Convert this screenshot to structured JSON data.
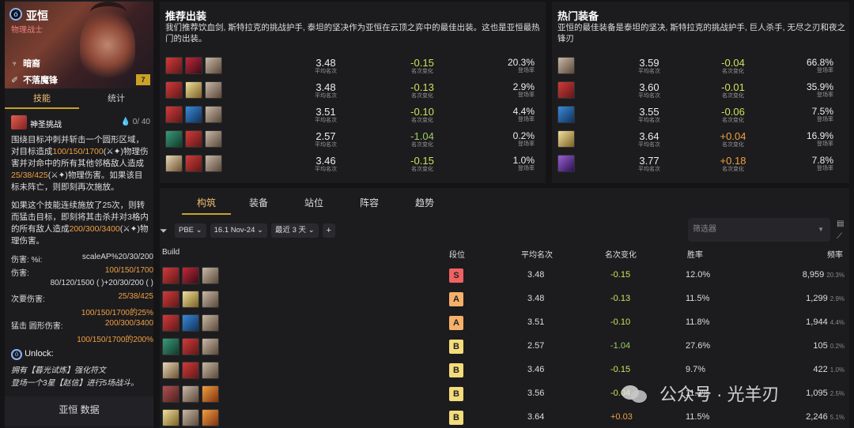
{
  "champion": {
    "name": "亚恒",
    "role": "物理战士",
    "cost": "7",
    "traits": [
      "暗裔",
      "不落魔锋"
    ],
    "tabs": [
      "技能",
      "统计"
    ],
    "ability": {
      "name": "神圣挑战",
      "mana": "0",
      "mana_max": "/ 40",
      "text1": "围绕目标冲刺并斩击一个圆形区域，对目标造成",
      "text1_num": "100/150/1700",
      "text1b": "物理伤害并对命中的所有其他邻格敌人造成",
      "text1_num2": "25/38/425",
      "text1c": "物理伤害。如果该目标未阵亡，则即刻再次施放。",
      "text2": "如果这个技能连续施放了25次，则转而猛击目标，即刻将其击杀并对3格内的所有敌人造成",
      "text2_num": "200/300/3400",
      "text2b": "物理伤害。"
    },
    "stats": [
      {
        "label": "伤害: %i:",
        "value": "scaleAP%20/30/200"
      },
      {
        "label": "伤害:",
        "value": "100/150/1700"
      },
      {
        "label": "",
        "value": "80/120/1500 (    )+20/30/200 (  )"
      },
      {
        "label": "次要伤害:",
        "value": "25/38/425"
      },
      {
        "label": "",
        "value": "100/150/1700的25%"
      },
      {
        "label": "猛击 圆形伤害:",
        "value": "200/300/3400"
      },
      {
        "label": "",
        "value": "100/150/1700的200%"
      }
    ],
    "unlock": {
      "title": "Unlock:",
      "line1": "拥有【暮光试炼】强化符文",
      "line2": "登场一个3星【赵信】进行5场战斗。"
    },
    "data_button": "亚恒 数据"
  },
  "recommended": {
    "title": "推荐出装",
    "desc": "我们推荐饮血剑, 斯特拉克的挑战护手, 泰坦的坚决作为亚恒在云顶之弈中的最佳出装。这也是亚恒最热门的出装。",
    "rows": [
      {
        "items": [
          "c1",
          "c2",
          "c3"
        ],
        "avg": "3.48",
        "chg": "-0.15",
        "chgc": "neg",
        "rate": "20.3%"
      },
      {
        "items": [
          "c1",
          "c4",
          "c3"
        ],
        "avg": "3.48",
        "chg": "-0.13",
        "chgc": "neg",
        "rate": "2.9%"
      },
      {
        "items": [
          "c1",
          "c5",
          "c3"
        ],
        "avg": "3.51",
        "chg": "-0.10",
        "chgc": "neg",
        "rate": "4.4%"
      },
      {
        "items": [
          "c6",
          "c1",
          "c3"
        ],
        "avg": "2.57",
        "chg": "-1.04",
        "chgc": "negg",
        "rate": "0.2%"
      },
      {
        "items": [
          "c7",
          "c1",
          "c3"
        ],
        "avg": "3.46",
        "chg": "-0.15",
        "chgc": "neg",
        "rate": "1.0%"
      }
    ],
    "lbl_avg": "平均名次",
    "lbl_chg": "名次变化",
    "lbl_rate": "登场率"
  },
  "popular": {
    "title": "热门装备",
    "desc": "亚恒的最佳装备是泰坦的坚决, 斯特拉克的挑战护手, 巨人杀手, 无尽之刃和夜之锋刃",
    "rows": [
      {
        "item": "c3",
        "avg": "3.59",
        "chg": "-0.04",
        "chgc": "neg",
        "rate": "66.8%"
      },
      {
        "item": "c1",
        "avg": "3.60",
        "chg": "-0.01",
        "chgc": "neg",
        "rate": "35.9%"
      },
      {
        "item": "c5",
        "avg": "3.55",
        "chg": "-0.06",
        "chgc": "neg",
        "rate": "7.5%"
      },
      {
        "item": "c4",
        "avg": "3.64",
        "chg": "+0.04",
        "chgc": "pos",
        "rate": "16.9%"
      },
      {
        "item": "c9",
        "avg": "3.77",
        "chg": "+0.18",
        "chgc": "pos",
        "rate": "7.8%"
      }
    ]
  },
  "bottom": {
    "tabs": [
      "构筑",
      "装备",
      "站位",
      "阵容",
      "趋势"
    ],
    "filters": [
      "PBE",
      "16.1 Nov-24",
      "最近 3 天"
    ],
    "plus": "+",
    "filter_placeholder": "筛选器",
    "headers": {
      "build": "Build",
      "tier": "段位",
      "avg": "平均名次",
      "chg": "名次变化",
      "win": "胜率",
      "freq": "频率"
    },
    "rows": [
      {
        "items": [
          "c1",
          "c2",
          "c3"
        ],
        "tier": "S",
        "avg": "3.48",
        "chg": "-0.15",
        "chgc": "neg",
        "win": "12.0%",
        "freq": "8,959",
        "pct": "20.3%"
      },
      {
        "items": [
          "c1",
          "c4",
          "c3"
        ],
        "tier": "A",
        "avg": "3.48",
        "chg": "-0.13",
        "chgc": "neg",
        "win": "11.5%",
        "freq": "1,299",
        "pct": "2.9%"
      },
      {
        "items": [
          "c1",
          "c5",
          "c3"
        ],
        "tier": "A",
        "avg": "3.51",
        "chg": "-0.10",
        "chgc": "neg",
        "win": "11.8%",
        "freq": "1,944",
        "pct": "4.4%"
      },
      {
        "items": [
          "c6",
          "c1",
          "c3"
        ],
        "tier": "B",
        "avg": "2.57",
        "chg": "-1.04",
        "chgc": "negg",
        "win": "27.6%",
        "freq": "105",
        "pct": "0.2%"
      },
      {
        "items": [
          "c7",
          "c1",
          "c3"
        ],
        "tier": "B",
        "avg": "3.46",
        "chg": "-0.15",
        "chgc": "neg",
        "win": "9.7%",
        "freq": "422",
        "pct": "1.0%"
      },
      {
        "items": [
          "c8",
          "c3",
          "c10"
        ],
        "tier": "B",
        "avg": "3.56",
        "chg": "-0.04",
        "chgc": "neg",
        "win": "11.3%",
        "freq": "1,095",
        "pct": "2.5%"
      },
      {
        "items": [
          "c4",
          "c3",
          "c10"
        ],
        "tier": "B",
        "avg": "3.64",
        "chg": "+0.03",
        "chgc": "pos",
        "win": "11.5%",
        "freq": "2,246",
        "pct": "5.1%"
      }
    ]
  },
  "watermark": "公众号 · 光羊刃"
}
